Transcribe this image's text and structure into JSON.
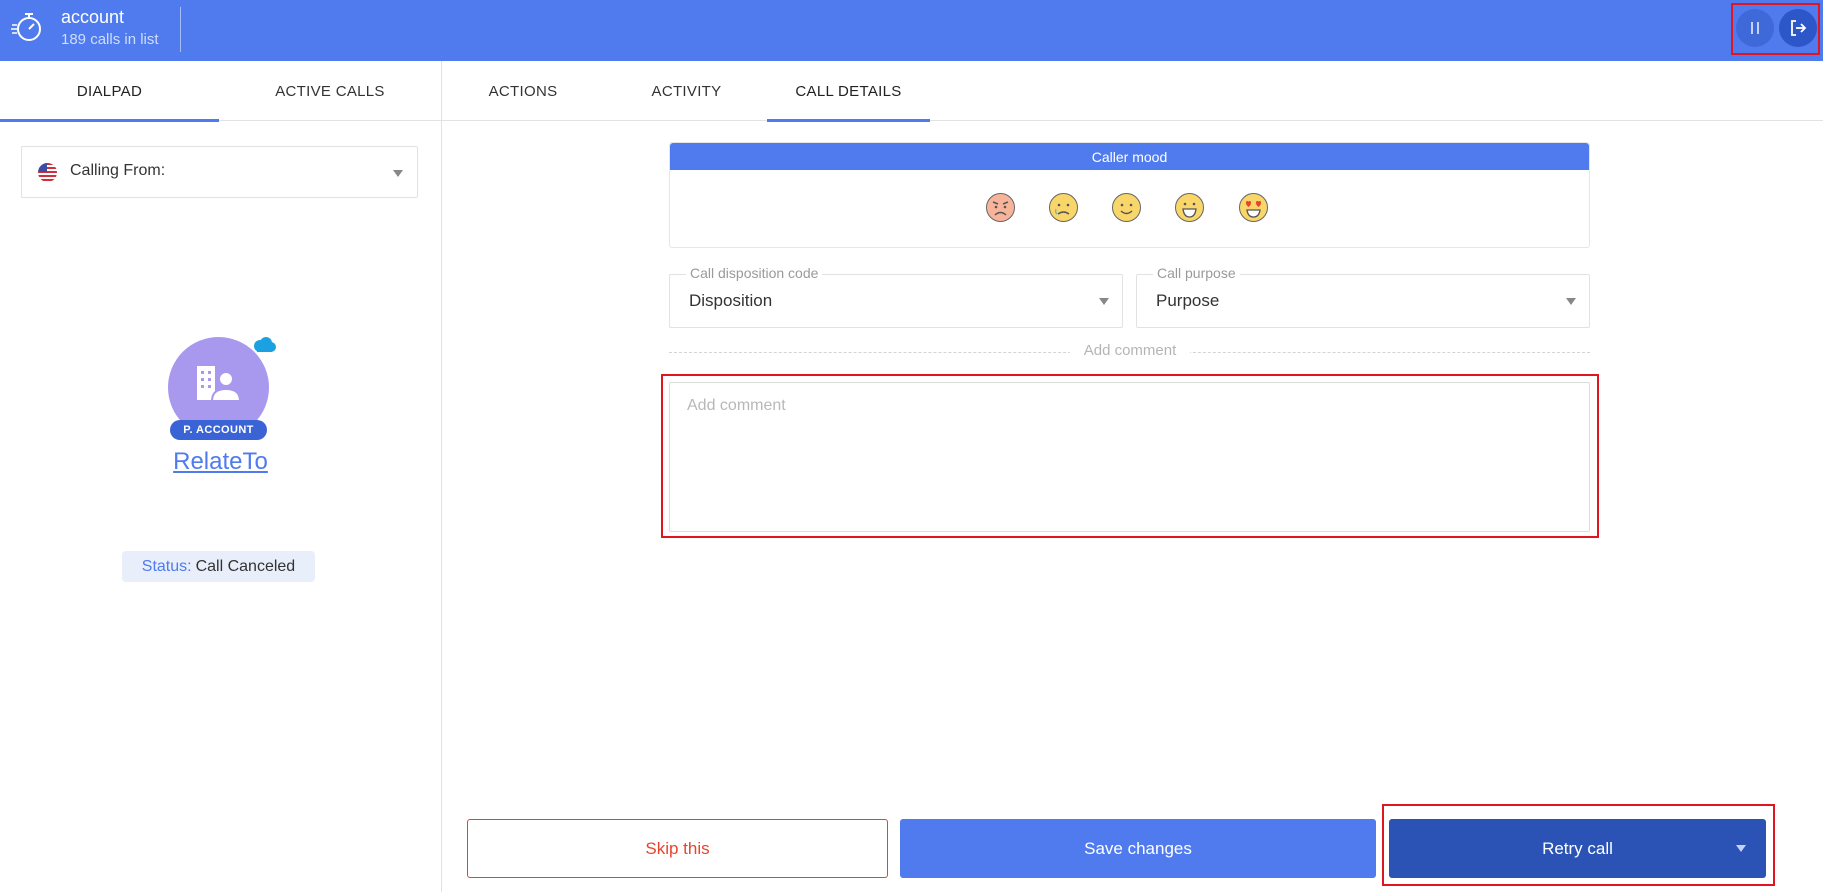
{
  "colors": {
    "primary": "#4f7bee",
    "primary_dark": "#2b53b5",
    "danger": "#e8442c",
    "highlight": "#e0151f",
    "avatar": "#a999ee"
  },
  "header": {
    "title": "account",
    "subtitle": "189 calls in list",
    "logo_icon": "stopwatch-icon",
    "pause_icon": "pause-icon",
    "logout_icon": "logout-icon"
  },
  "left_tabs": [
    {
      "label": "DIALPAD",
      "active": true
    },
    {
      "label": "ACTIVE CALLS",
      "active": false
    }
  ],
  "right_tabs": [
    {
      "label": "ACTIONS",
      "active": false
    },
    {
      "label": "ACTIVITY",
      "active": false
    },
    {
      "label": "CALL DETAILS",
      "active": true
    }
  ],
  "calling_from": {
    "label": "Calling From:",
    "flag_icon": "us-flag-icon"
  },
  "contact": {
    "badge": "P. ACCOUNT",
    "name": "RelateTo",
    "crm_icon": "salesforce-cloud-icon",
    "status_key": "Status:",
    "status_value": "Call Canceled"
  },
  "mood": {
    "title": "Caller mood",
    "options": [
      "angry-face-icon",
      "sad-face-icon",
      "smiling-face-icon",
      "grinning-face-icon",
      "heart-eyes-face-icon"
    ]
  },
  "disposition": {
    "legend": "Call disposition code",
    "value": "Disposition"
  },
  "purpose": {
    "legend": "Call purpose",
    "value": "Purpose"
  },
  "comment": {
    "separator_label": "Add comment",
    "placeholder": "Add comment"
  },
  "actions": {
    "skip": "Skip this",
    "save": "Save changes",
    "retry": "Retry call"
  }
}
